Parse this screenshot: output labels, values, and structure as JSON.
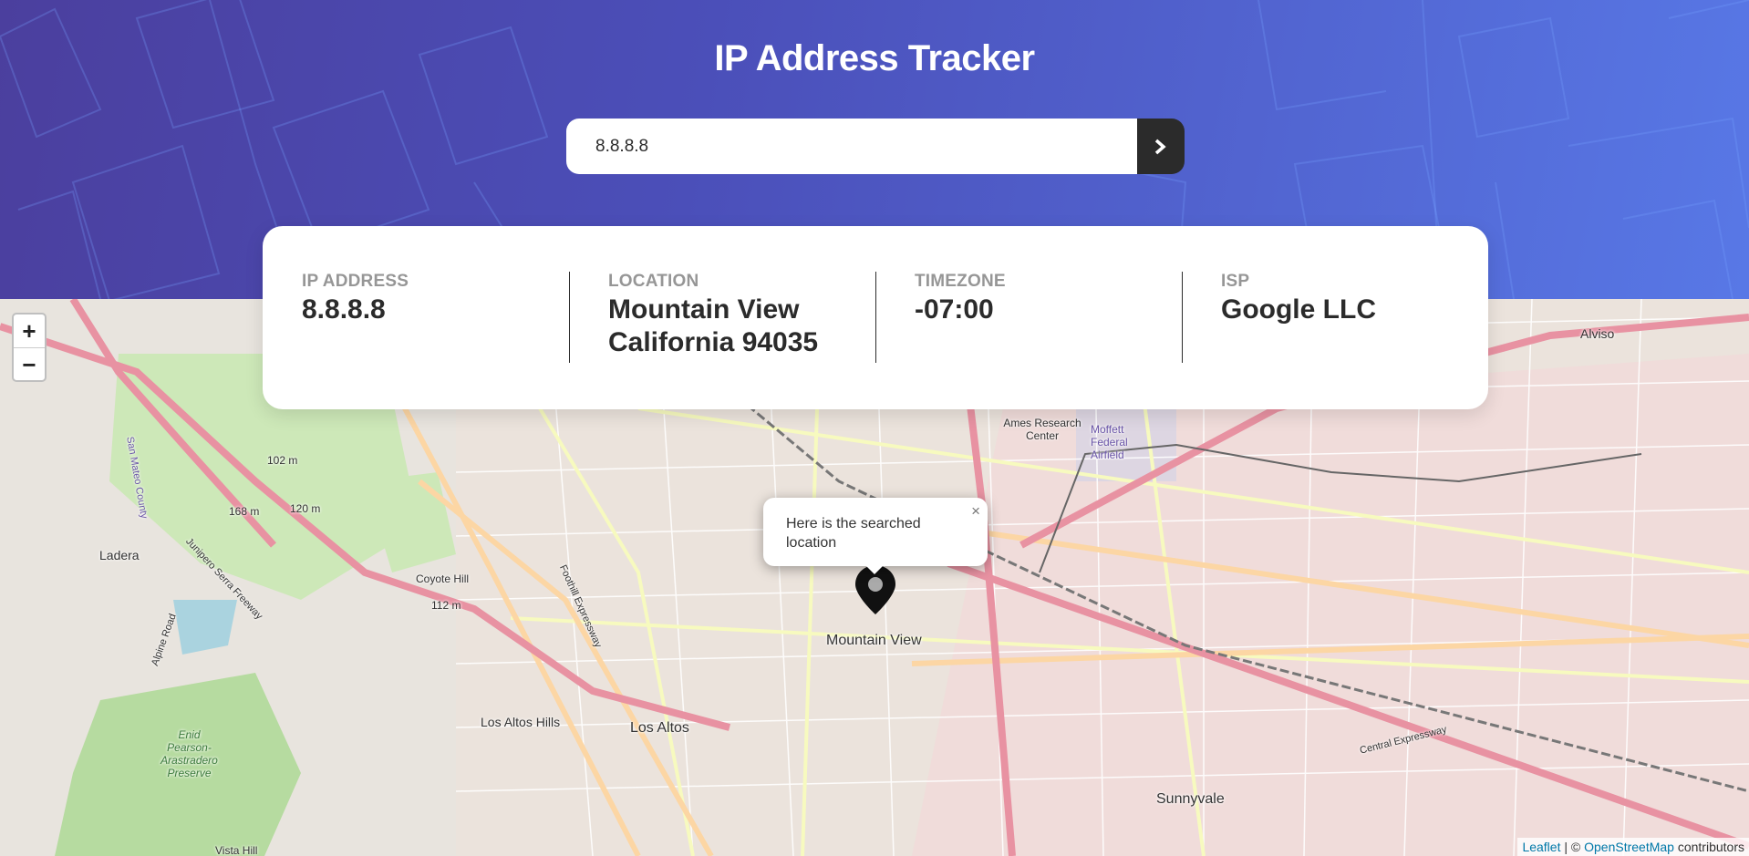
{
  "header": {
    "title": "IP Address Tracker"
  },
  "search": {
    "value": "8.8.8.8",
    "submit_icon": "chevron-right-icon"
  },
  "info": [
    {
      "label": "IP ADDRESS",
      "value": "8.8.8.8"
    },
    {
      "label": "LOCATION",
      "value_line1": "Mountain View",
      "value_line2": "California 94035"
    },
    {
      "label": "TIMEZONE",
      "value": "-07:00"
    },
    {
      "label": "ISP",
      "value": "Google LLC"
    }
  ],
  "map": {
    "zoom_in": "+",
    "zoom_out": "−",
    "popup_text": "Here is the searched location",
    "popup_close": "×",
    "labels": [
      "Mountain View",
      "Los Altos",
      "Los Altos Hills",
      "Sunnyvale",
      "Ladera",
      "Coyote Hill",
      "112 m",
      "102 m",
      "168 m",
      "120 m",
      "Ames Research Center",
      "Moffett Federal Airfield",
      "Alviso",
      "Enid Pearson-Arastradero Preserve",
      "Vista Hill",
      "Junipero Serra Freeway",
      "Foothill Expressway",
      "Central Expressway",
      "Alpine Road",
      "San Mateo County"
    ],
    "attribution": {
      "leaflet": "Leaflet",
      "sep": " | © ",
      "osm": "OpenStreetMap",
      "contributors": " contributors"
    }
  },
  "colors": {
    "accent_dark": "#2b2b2b",
    "gradient_start": "#4b3f9e",
    "gradient_end": "#5878e6"
  }
}
